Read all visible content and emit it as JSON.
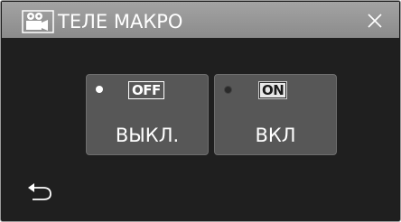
{
  "header": {
    "title": "ТЕЛЕ МАКРО",
    "mode_icon": "video-camera-icon",
    "close_icon": "close-icon"
  },
  "options": [
    {
      "state_badge": "OFF",
      "label": "ВЫКЛ.",
      "selected": false
    },
    {
      "state_badge": "ON",
      "label": "ВКЛ",
      "selected": true
    }
  ],
  "footer": {
    "back_icon": "back-arrow-icon"
  },
  "colors": {
    "header_bg": "#999999",
    "body_bg": "#1f1f1f",
    "button_bg": "#575757",
    "text": "#ffffff"
  }
}
